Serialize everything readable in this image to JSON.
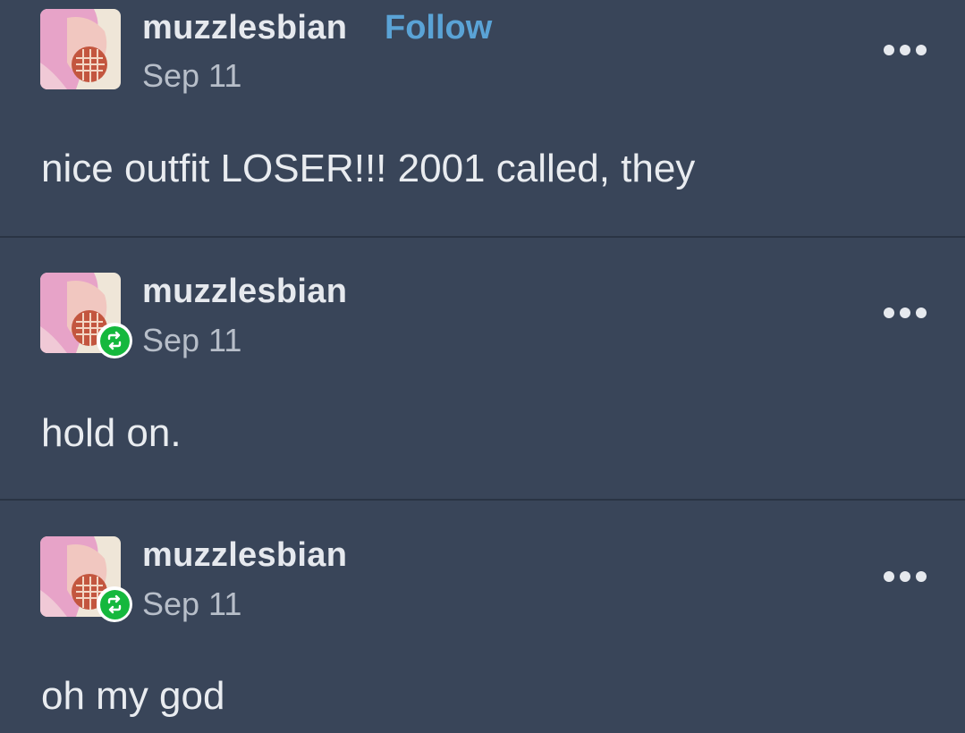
{
  "colors": {
    "background": "#394559",
    "username": "#e6e9ee",
    "follow": "#5aa3d6",
    "date": "#b7bec9",
    "reblog_badge": "#15b83d"
  },
  "posts": [
    {
      "username": "muzzlesbian",
      "follow_label": "Follow",
      "date": "Sep 11",
      "text": "nice outfit LOSER!!! 2001 called, they",
      "reblogged": false
    },
    {
      "username": "muzzlesbian",
      "date": "Sep 11",
      "text": "hold on.",
      "reblogged": true
    },
    {
      "username": "muzzlesbian",
      "date": "Sep 11",
      "text": "oh my god",
      "reblogged": true
    }
  ],
  "icons": {
    "avatar": "avatar-image",
    "reblog": "reblog-icon",
    "more": "more-options-icon"
  }
}
